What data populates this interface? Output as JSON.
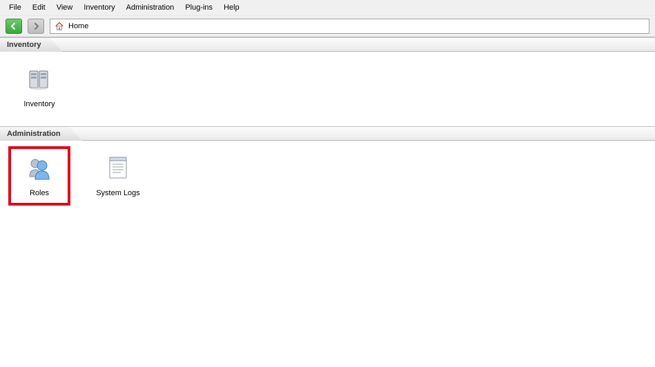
{
  "menu": {
    "items": [
      "File",
      "Edit",
      "View",
      "Inventory",
      "Administration",
      "Plug-ins",
      "Help"
    ]
  },
  "toolbar": {
    "location": "Home"
  },
  "sections": {
    "inventory": {
      "title": "Inventory",
      "items": [
        {
          "label": "Inventory"
        }
      ]
    },
    "administration": {
      "title": "Administration",
      "items": [
        {
          "label": "Roles"
        },
        {
          "label": "System Logs"
        }
      ]
    }
  }
}
